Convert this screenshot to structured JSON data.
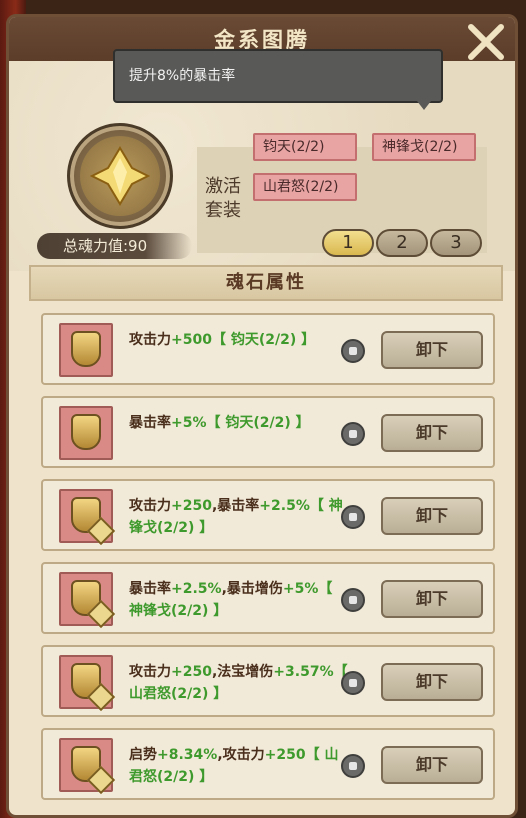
{
  "title": "金系图腾",
  "tooltip": "提升8%的暴击率",
  "suits": {
    "label_line1": "激活",
    "label_line2": "套装",
    "items": [
      "钧天(2/2)",
      "神锋戈(2/2)",
      "山君怒(2/2)"
    ]
  },
  "total_power": "总魂力值:90",
  "pages": [
    "1",
    "2",
    "3"
  ],
  "active_page": "1",
  "section_title": "魂石属性",
  "rows": [
    {
      "parts": [
        {
          "t": "攻击力",
          "c": "normal"
        },
        {
          "t": "+500",
          "c": "green"
        },
        {
          "t": "【 钧天(2/2) 】",
          "c": "green"
        }
      ],
      "has_sub": false,
      "button": "卸下"
    },
    {
      "parts": [
        {
          "t": "暴击率",
          "c": "normal"
        },
        {
          "t": "+5%",
          "c": "green"
        },
        {
          "t": "【 钧天(2/2) 】",
          "c": "green"
        }
      ],
      "has_sub": false,
      "button": "卸下"
    },
    {
      "parts": [
        {
          "t": "攻击力",
          "c": "normal"
        },
        {
          "t": "+250",
          "c": "green"
        },
        {
          "t": ",暴击率",
          "c": "normal"
        },
        {
          "t": "+2.5%",
          "c": "green"
        },
        {
          "t": "【 神锋戈(2/2) 】",
          "c": "green"
        }
      ],
      "has_sub": true,
      "button": "卸下"
    },
    {
      "parts": [
        {
          "t": "暴击率",
          "c": "normal"
        },
        {
          "t": "+2.5%",
          "c": "green"
        },
        {
          "t": ",暴击增伤",
          "c": "normal"
        },
        {
          "t": "+5%",
          "c": "green"
        },
        {
          "t": "【 神锋戈(2/2) 】",
          "c": "green"
        }
      ],
      "has_sub": true,
      "button": "卸下"
    },
    {
      "parts": [
        {
          "t": "攻击力",
          "c": "normal"
        },
        {
          "t": "+250",
          "c": "green"
        },
        {
          "t": ",法宝增伤",
          "c": "normal"
        },
        {
          "t": "+3.57%",
          "c": "green"
        },
        {
          "t": "【 山君怒(2/2) 】",
          "c": "green"
        }
      ],
      "has_sub": true,
      "button": "卸下"
    },
    {
      "parts": [
        {
          "t": "启势",
          "c": "normal"
        },
        {
          "t": "+8.34%",
          "c": "green"
        },
        {
          "t": ",攻击力",
          "c": "normal"
        },
        {
          "t": "+250",
          "c": "green"
        },
        {
          "t": "【 山君怒(2/2) 】",
          "c": "green"
        }
      ],
      "has_sub": true,
      "button": "卸下"
    }
  ],
  "colors": {
    "positive": "#3f9a2d",
    "tag_fill": "#e8a3a3",
    "active_page": "#d9b84f"
  }
}
